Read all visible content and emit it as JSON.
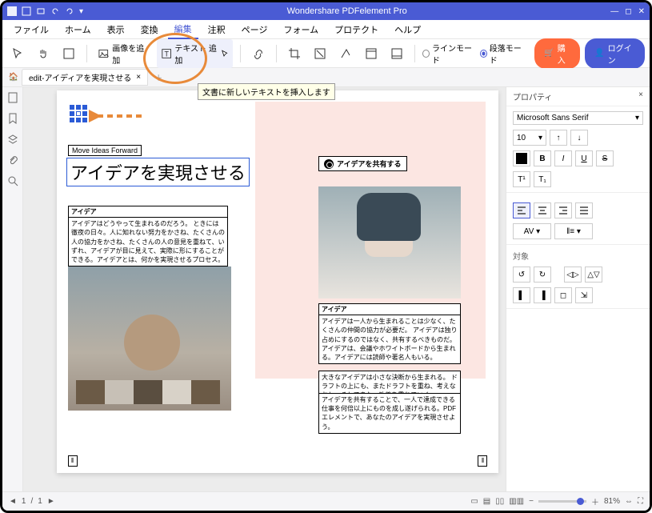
{
  "titlebar": {
    "app_title": "Wondershare PDFelement Pro"
  },
  "menu": {
    "file": "ファイル",
    "home": "ホーム",
    "view": "表示",
    "convert": "変換",
    "edit": "編集",
    "annotate": "注釈",
    "page": "ページ",
    "form": "フォーム",
    "protect": "プロテクト",
    "help": "ヘルプ"
  },
  "toolbar": {
    "add_image": "画像を追加",
    "add_text": "テキスト 追加",
    "line_mode": "ラインモード",
    "paragraph_mode": "段落モード",
    "buy": "購入",
    "login": "ログイン"
  },
  "tooltip": "文書に新しいテキストを挿入します",
  "tab": {
    "name": "edit-アイディアを実現させる"
  },
  "doc": {
    "tagline": "Move Ideas Forward",
    "heading": "アイデアを実現させる",
    "share_label": "アイデアを共有する",
    "b1_hd": "アイデア",
    "b1_bd": "アイデアはどうやって生まれるのだろう。\nときには徹夜の日々。人に知れない努力をかさね、たくさんの人の協力をかさね、たくさんの人の意見を重ねて、いずれ、アイデアが目に見えて、実際に形にすることができる。アイデアとは、何かを実現させるプロセス。",
    "b2_hd": "アイデア",
    "b2_bd": "アイデアは一人から生まれることは少なく、たくさんの仲間の協力が必要だ。\nアイデアは独り占めにするのではなく、共有するべきものだ。\nアイデアは、会議やホワイトボードから生まれる。アイデアには読師や著名人もいる。",
    "b3_bd": "大きなアイデアは小さな決断から生まれる。\nドラフトの上にも、またドラフトを重ね、考えなおし、そしてまた、改善を重ねていく。",
    "b4_bd": "アイデアを共有することで、一人で達成できる仕事を何倍以上にものを成し遂げられる。PDFエレメントで、あなたのアイデアを実現させよう。"
  },
  "properties": {
    "panel_title": "プロパティ",
    "font_name": "Microsoft Sans Serif",
    "font_size": "10",
    "target_label": "対象"
  },
  "status": {
    "page": "1",
    "pages": "1",
    "zoom": "81%"
  }
}
